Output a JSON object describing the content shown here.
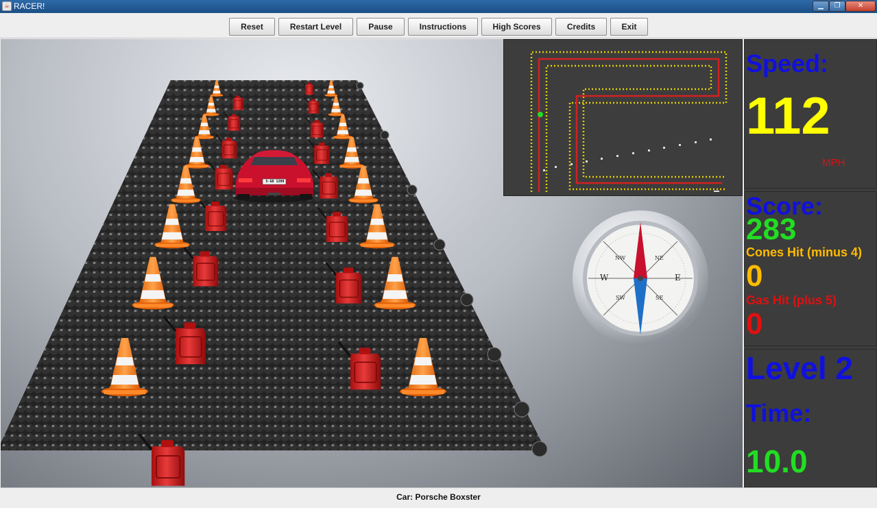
{
  "window": {
    "title": "RACER!",
    "minimize_glyph": "▁",
    "maximize_glyph": "❐",
    "close_glyph": "✕"
  },
  "toolbar": {
    "reset": "Reset",
    "restart_level": "Restart Level",
    "pause": "Pause",
    "instructions": "Instructions",
    "high_scores": "High Scores",
    "credits": "Credits",
    "exit": "Exit"
  },
  "hud": {
    "speed_label": "Speed:",
    "speed_value": "112",
    "speed_unit": "MPH",
    "score_label": "Score:",
    "score_value": "283",
    "cones_label": "Cones Hit (minus 4)",
    "cones_value": "0",
    "gas_label": "Gas Hit (plus 5)",
    "gas_value": "0",
    "level_label": "Level 2",
    "time_label": "Time:",
    "time_value": "10.0"
  },
  "compass": {
    "n": "",
    "e": "E",
    "w": "W",
    "ne": "NE",
    "nw": "NW",
    "se": "SE",
    "sw": "SW"
  },
  "car": {
    "plate": "S·GO 1209"
  },
  "status": {
    "car_text": "Car: Porsche Boxster"
  },
  "colors": {
    "speed_label": "#1010e0",
    "speed_value": "#ffff00",
    "speed_unit": "#e01010",
    "score_label": "#1010e0",
    "score_value": "#22dd22",
    "cones": "#ffbb00",
    "gas": "#e01010",
    "level": "#1010e0",
    "time_label": "#1010e0",
    "time_value": "#22dd22"
  },
  "icons": {
    "app": "racer-app-icon",
    "compass": "compass-icon",
    "cone": "traffic-cone-icon",
    "gas": "gas-can-icon",
    "player": "car-icon"
  }
}
